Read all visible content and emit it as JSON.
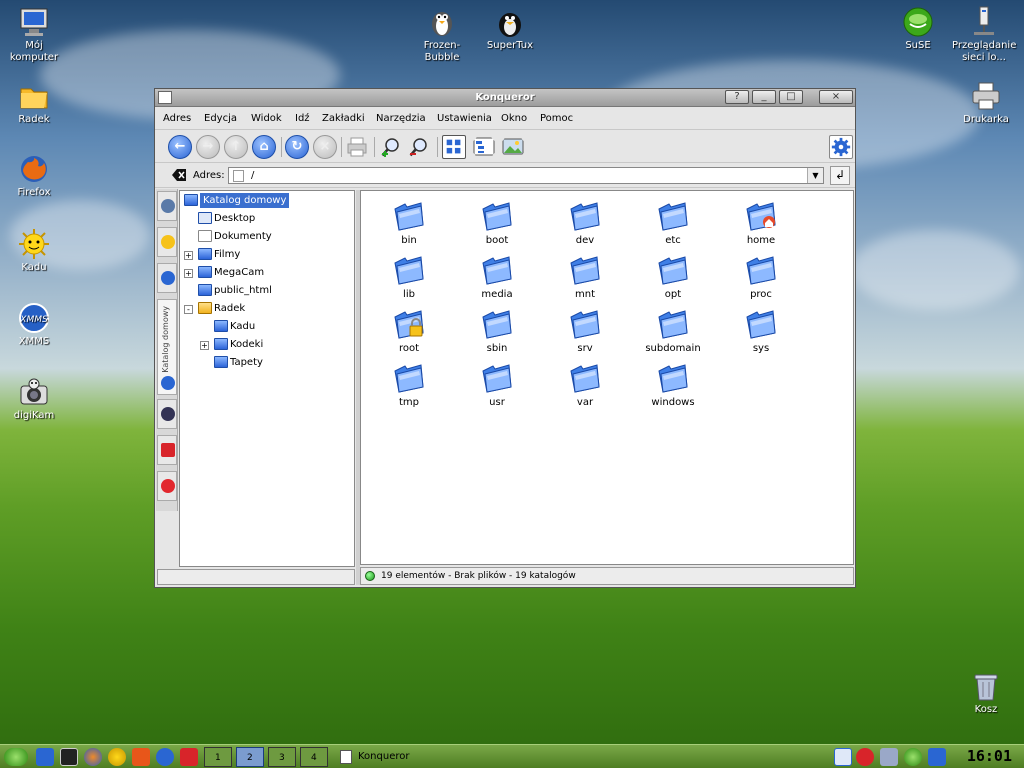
{
  "desktop": {
    "icons": [
      {
        "label": "Mój komputer",
        "icon": "computer-icon"
      },
      {
        "label": "Radek",
        "icon": "home-folder-icon"
      },
      {
        "label": "Firefox",
        "icon": "firefox-icon"
      },
      {
        "label": "Kadu",
        "icon": "kadu-sun-icon"
      },
      {
        "label": "XMMS",
        "icon": "xmms-icon"
      },
      {
        "label": "digiKam",
        "icon": "digikam-camera-icon"
      },
      {
        "label": "Frozen-Bubble",
        "icon": "frozen-bubble-penguin-icon"
      },
      {
        "label": "SuperTux",
        "icon": "supertux-penguin-icon"
      },
      {
        "label": "SuSE",
        "icon": "suse-logo-icon"
      },
      {
        "label": "Przeglądanie sieci lo...",
        "icon": "network-browse-icon"
      },
      {
        "label": "Drukarka",
        "icon": "printer-icon"
      },
      {
        "label": "Kosz",
        "icon": "trash-icon"
      }
    ]
  },
  "window": {
    "title": "Konqueror",
    "buttons": [
      "?",
      "_",
      "□",
      "×"
    ],
    "menu": [
      "Adres",
      "Edycja",
      "Widok",
      "Idź",
      "Zakładki",
      "Narzędzia",
      "Ustawienia",
      "Okno",
      "Pomoc"
    ],
    "toolbar": [
      "back",
      "forward",
      "up",
      "home",
      "reload",
      "stop",
      "print",
      "zoom-in",
      "zoom-out",
      "icon-view",
      "tree-view",
      "sidebar-toggle",
      "configure"
    ],
    "address_label": "Adres:",
    "address_value": "/"
  },
  "tree": {
    "items": [
      {
        "label": "Katalog domowy",
        "level": 0,
        "expander": "",
        "selected": true
      },
      {
        "label": "Desktop",
        "level": 1,
        "expander": ""
      },
      {
        "label": "Dokumenty",
        "level": 1,
        "expander": ""
      },
      {
        "label": "Filmy",
        "level": 1,
        "expander": "+"
      },
      {
        "label": "MegaCam",
        "level": 1,
        "expander": "+"
      },
      {
        "label": "public_html",
        "level": 1,
        "expander": ""
      },
      {
        "label": "Radek",
        "level": 1,
        "expander": "-"
      },
      {
        "label": "Kadu",
        "level": 2,
        "expander": ""
      },
      {
        "label": "Kodeki",
        "level": 2,
        "expander": "+"
      },
      {
        "label": "Tapety",
        "level": 2,
        "expander": ""
      }
    ],
    "sidebar_tab_vertical_label": "Katalog domowy"
  },
  "files": [
    "bin",
    "boot",
    "dev",
    "etc",
    "home",
    "lib",
    "media",
    "mnt",
    "opt",
    "proc",
    "root",
    "sbin",
    "srv",
    "subdomain",
    "sys",
    "tmp",
    "usr",
    "var",
    "windows"
  ],
  "status": "19 elementów - Brak plików - 19 katalogów",
  "taskbar": {
    "pagers": [
      "1",
      "2",
      "3",
      "4"
    ],
    "active_pager": "2",
    "task": "Konqueror",
    "clock": "16:01"
  }
}
